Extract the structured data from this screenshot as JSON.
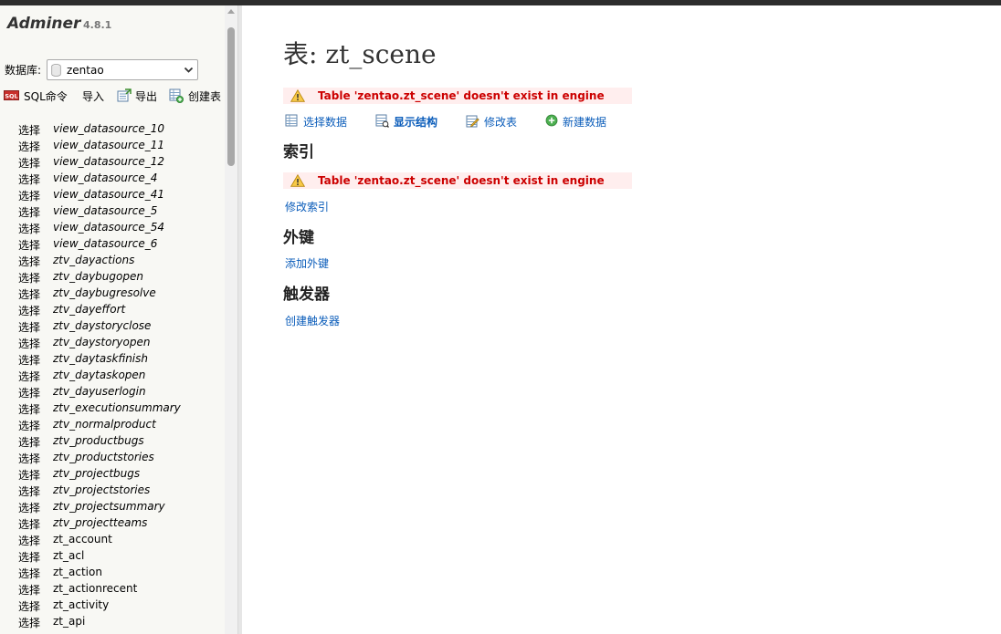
{
  "app": {
    "name": "Adminer",
    "version": "4.8.1"
  },
  "database": {
    "label": "数据库:",
    "value": "zentao"
  },
  "actions": [
    {
      "label": "SQL命令",
      "icon": "sql-icon"
    },
    {
      "label": "导入",
      "icon": ""
    },
    {
      "label": "导出",
      "icon": "export-icon"
    },
    {
      "label": "创建表",
      "icon": "create-table-icon"
    }
  ],
  "table_select_label": "选择",
  "tables": [
    {
      "name": "view_datasource_10",
      "view": true
    },
    {
      "name": "view_datasource_11",
      "view": true
    },
    {
      "name": "view_datasource_12",
      "view": true
    },
    {
      "name": "view_datasource_4",
      "view": true
    },
    {
      "name": "view_datasource_41",
      "view": true
    },
    {
      "name": "view_datasource_5",
      "view": true
    },
    {
      "name": "view_datasource_54",
      "view": true
    },
    {
      "name": "view_datasource_6",
      "view": true
    },
    {
      "name": "ztv_dayactions",
      "view": true
    },
    {
      "name": "ztv_daybugopen",
      "view": true
    },
    {
      "name": "ztv_daybugresolve",
      "view": true
    },
    {
      "name": "ztv_dayeffort",
      "view": true
    },
    {
      "name": "ztv_daystoryclose",
      "view": true
    },
    {
      "name": "ztv_daystoryopen",
      "view": true
    },
    {
      "name": "ztv_daytaskfinish",
      "view": true
    },
    {
      "name": "ztv_daytaskopen",
      "view": true
    },
    {
      "name": "ztv_dayuserlogin",
      "view": true
    },
    {
      "name": "ztv_executionsummary",
      "view": true
    },
    {
      "name": "ztv_normalproduct",
      "view": true
    },
    {
      "name": "ztv_productbugs",
      "view": true
    },
    {
      "name": "ztv_productstories",
      "view": true
    },
    {
      "name": "ztv_projectbugs",
      "view": true
    },
    {
      "name": "ztv_projectstories",
      "view": true
    },
    {
      "name": "ztv_projectsummary",
      "view": true
    },
    {
      "name": "ztv_projectteams",
      "view": true
    },
    {
      "name": "zt_account",
      "view": false
    },
    {
      "name": "zt_acl",
      "view": false
    },
    {
      "name": "zt_action",
      "view": false
    },
    {
      "name": "zt_actionrecent",
      "view": false
    },
    {
      "name": "zt_activity",
      "view": false
    },
    {
      "name": "zt_api",
      "view": false
    }
  ],
  "main": {
    "title": "表: zt_scene",
    "error_message": "Table 'zentao.zt_scene' doesn't exist in engine",
    "links": [
      {
        "label": "选择数据",
        "icon": "select-data-icon",
        "bold": false
      },
      {
        "label": "显示结构",
        "icon": "show-structure-icon",
        "bold": true
      },
      {
        "label": "修改表",
        "icon": "alter-table-icon",
        "bold": false
      },
      {
        "label": "新建数据",
        "icon": "new-item-icon",
        "bold": false
      }
    ],
    "indexes": {
      "heading": "索引",
      "link": "修改索引"
    },
    "foreign_keys": {
      "heading": "外键",
      "link": "添加外键"
    },
    "triggers": {
      "heading": "触发器",
      "link": "创建触发器"
    }
  },
  "colors": {
    "link": "#0a5cba",
    "error_text": "#cc0000",
    "error_bg": "#ffeeee",
    "sidebar_bg": "#f8f8f4"
  }
}
